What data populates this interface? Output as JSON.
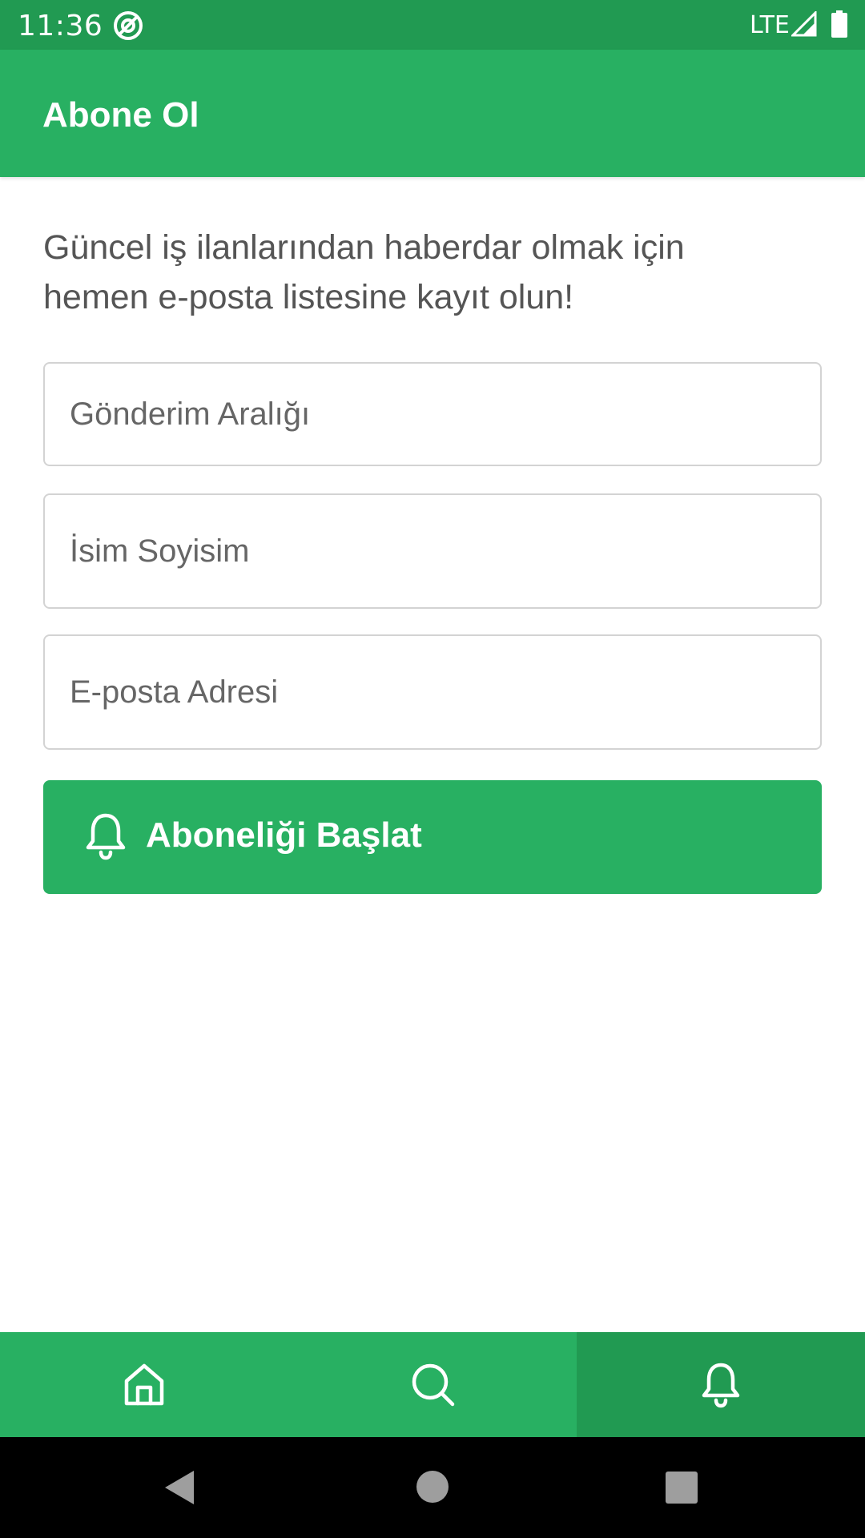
{
  "status_bar": {
    "time": "11:36",
    "network": "LTE",
    "app_icon": "at-sign-icon",
    "signal_icon": "signal-icon",
    "battery_icon": "battery-icon"
  },
  "app_bar": {
    "title": "Abone Ol"
  },
  "main": {
    "intro_line1": "Güncel iş ilanlarından haberdar olmak için",
    "intro_line2": "hemen e-posta listesine kayıt olun!",
    "fields": [
      {
        "placeholder": "Gönderim Aralığı"
      },
      {
        "placeholder": "İsim Soyisim"
      },
      {
        "placeholder": "E-posta Adresi"
      }
    ],
    "subscribe_button": {
      "label": "Aboneliği Başlat",
      "icon": "bell-icon"
    }
  },
  "bottom_nav": {
    "items": [
      {
        "icon": "home-icon",
        "active": false
      },
      {
        "icon": "search-icon",
        "active": false
      },
      {
        "icon": "bell-icon",
        "active": true
      }
    ]
  },
  "system_nav": {
    "items": [
      "back-icon",
      "home-circle-icon",
      "recents-icon"
    ]
  },
  "colors": {
    "primary": "#28b062",
    "primary_dark": "#219a52",
    "text": "#555555",
    "border": "#d3d3d3"
  }
}
